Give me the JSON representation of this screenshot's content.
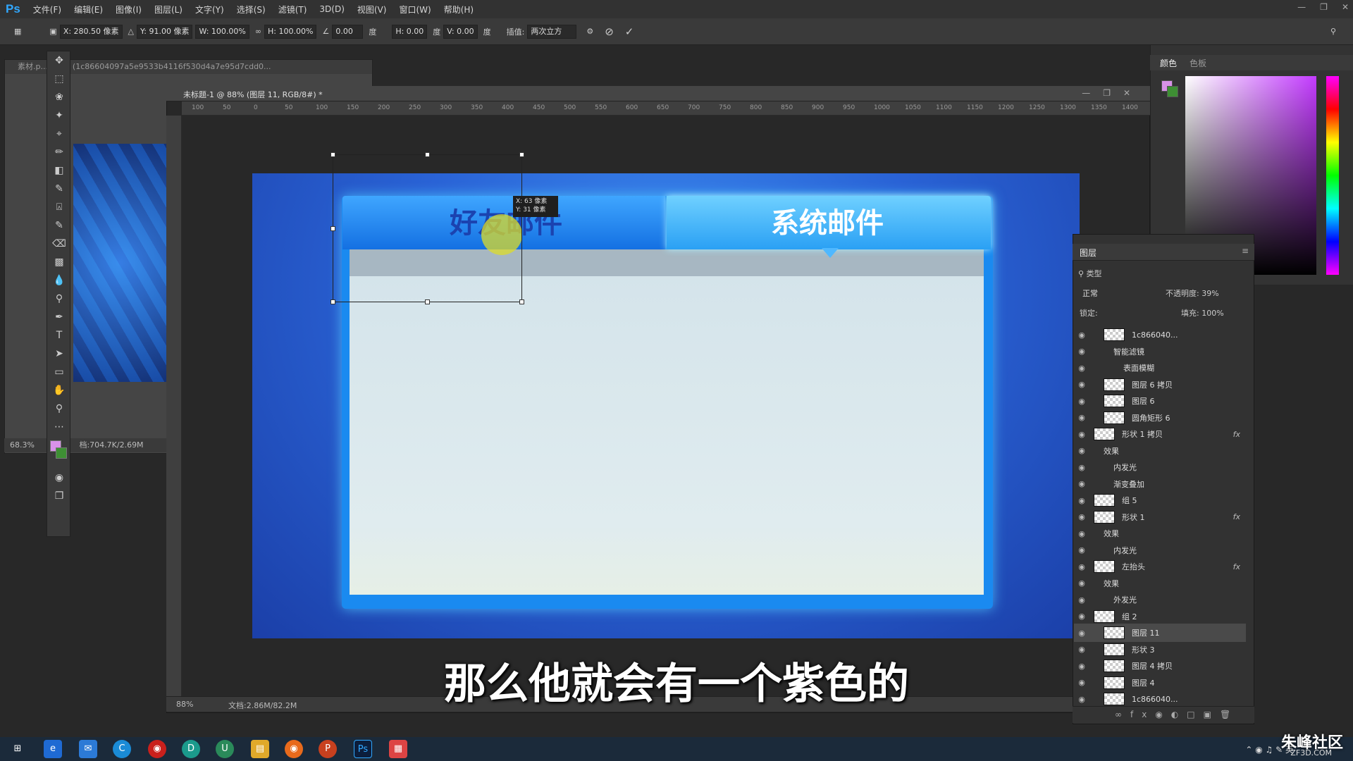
{
  "app": {
    "logo": "Ps"
  },
  "menubar": {
    "items": [
      "文件(F)",
      "编辑(E)",
      "图像(I)",
      "图层(L)",
      "文字(Y)",
      "选择(S)",
      "滤镜(T)",
      "3D(D)",
      "视图(V)",
      "窗口(W)",
      "帮助(H)"
    ]
  },
  "options": {
    "x": "X: 280.50 像素",
    "y": "Y: 91.00 像素",
    "w": "W: 100.00%",
    "h": "H: 100.00%",
    "angle": "0.00",
    "deg": "度",
    "hskew": "H: 0.00",
    "vskew": "V: 0.00",
    "interp_label": "插值:",
    "interp_value": "两次立方"
  },
  "doc2": {
    "title": "素材.p... 8.3% (1c86604097a5e9533b4116f530d4a7e95d7cdd0...",
    "zoom": "68.3%",
    "docsize": "档:704.7K/2.69M"
  },
  "main": {
    "title": "未标题-1 @ 88% (图层 11, RGB/8#) *",
    "zoom": "88%",
    "docsize": "文档:2.86M/82.2M",
    "ruler_h": [
      "100",
      "50",
      "0",
      "50",
      "100",
      "150",
      "200",
      "250",
      "300",
      "350",
      "400",
      "450",
      "500",
      "550",
      "600",
      "650",
      "700",
      "750",
      "800",
      "850",
      "900",
      "950",
      "1000",
      "1050",
      "1100",
      "1150",
      "1200",
      "1250",
      "1300",
      "1350",
      "1400"
    ]
  },
  "artwork": {
    "tab_left": "好友邮件",
    "tab_right": "系统邮件",
    "tooltip_l1": "X: 63 像素",
    "tooltip_l2": "Y: 31 像素"
  },
  "caption": "那么他就会有一个紫色的",
  "color_panel": {
    "tab_color": "颜色",
    "tab_swatches": "色板",
    "fg": "#d892e8",
    "bg": "#3e8f34"
  },
  "layers_panel": {
    "title": "图层",
    "filter": "类型",
    "blend": "正常",
    "opacity_label": "不透明度:",
    "opacity": "39%",
    "lock_label": "锁定:",
    "fill_label": "填充:",
    "fill": "100%",
    "rows": [
      {
        "name": "1c866040...",
        "indent": 1,
        "fx": ""
      },
      {
        "name": "智能滤镜",
        "indent": 2,
        "fx": ""
      },
      {
        "name": "表面模糊",
        "indent": 3,
        "fx": ""
      },
      {
        "name": "图层 6 拷贝",
        "indent": 1,
        "fx": ""
      },
      {
        "name": "图层 6",
        "indent": 1,
        "fx": ""
      },
      {
        "name": "圆角矩形 6",
        "indent": 1,
        "fx": ""
      },
      {
        "name": "形状 1 拷贝",
        "indent": 0,
        "fx": "fx"
      },
      {
        "name": "效果",
        "indent": 1,
        "fx": ""
      },
      {
        "name": "内发光",
        "indent": 2,
        "fx": ""
      },
      {
        "name": "渐变叠加",
        "indent": 2,
        "fx": ""
      },
      {
        "name": "组 5",
        "indent": 0,
        "fx": ""
      },
      {
        "name": "形状 1",
        "indent": 0,
        "fx": "fx"
      },
      {
        "name": "效果",
        "indent": 1,
        "fx": ""
      },
      {
        "name": "内发光",
        "indent": 2,
        "fx": ""
      },
      {
        "name": "左抬头",
        "indent": 0,
        "fx": "fx"
      },
      {
        "name": "效果",
        "indent": 1,
        "fx": ""
      },
      {
        "name": "外发光",
        "indent": 2,
        "fx": ""
      },
      {
        "name": "组 2",
        "indent": 0,
        "fx": ""
      },
      {
        "name": "图层 11",
        "indent": 1,
        "fx": ""
      },
      {
        "name": "形状 3",
        "indent": 1,
        "fx": ""
      },
      {
        "name": "图层 4 拷贝",
        "indent": 1,
        "fx": ""
      },
      {
        "name": "图层 4",
        "indent": 1,
        "fx": ""
      },
      {
        "name": "1c866040...",
        "indent": 1,
        "fx": ""
      }
    ]
  },
  "taskbar": {
    "tray_text": "英",
    "watermark": "朱峰社区",
    "watermark_sub": "ZF3D.COM"
  }
}
